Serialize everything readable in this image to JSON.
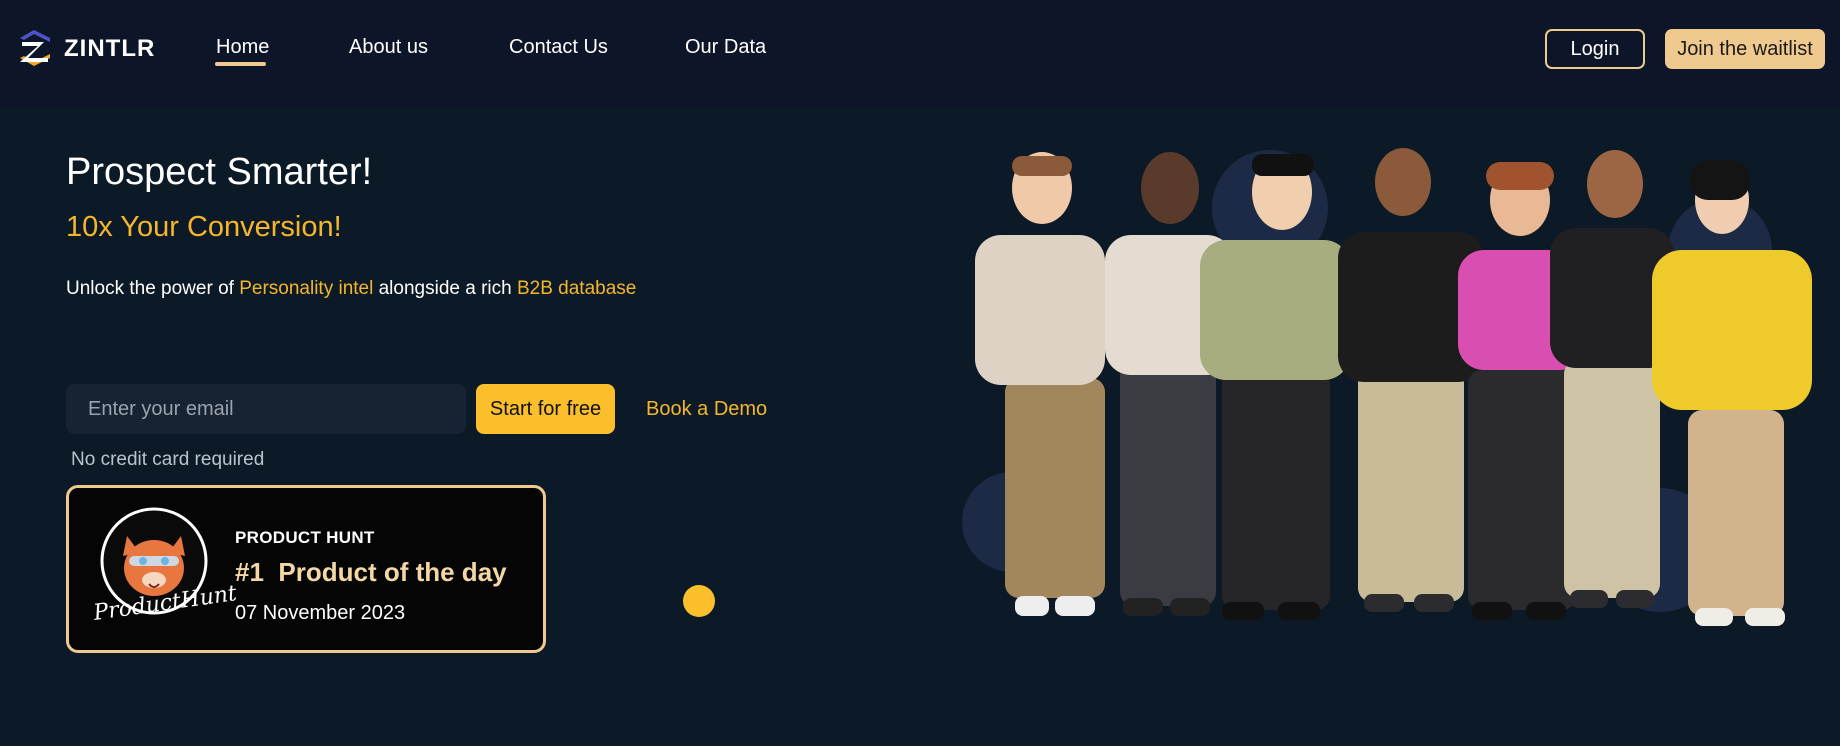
{
  "brand": {
    "name": "ZINTLR",
    "accent": "#f5b52c",
    "nav_bg": "#0d1628",
    "page_bg": "#0c1a27",
    "badge_border": "#f0c98e"
  },
  "nav": {
    "links": [
      {
        "label": "Home",
        "active": true
      },
      {
        "label": "About us"
      },
      {
        "label": "Contact Us"
      },
      {
        "label": "Our Data"
      }
    ],
    "login_label": "Login",
    "waitlist_label": "Join the waitlist"
  },
  "hero": {
    "title": "Prospect Smarter!",
    "subtitle": "10x Your Conversion!",
    "tagline": {
      "prefix": "Unlock the power of ",
      "highlight1": "Personality intel",
      "middle": " alongside a rich ",
      "highlight2": "B2B database"
    },
    "email_placeholder": "Enter your email",
    "start_label": "Start for free",
    "demo_label": "Book a Demo",
    "note": "No credit card required"
  },
  "product_hunt": {
    "label": "PRODUCT HUNT",
    "rank": "#1",
    "title": "Product of the day",
    "date": "07 November 2023",
    "script": "ProductHunt"
  },
  "illustration": {
    "icon": "people-group-illustration"
  }
}
